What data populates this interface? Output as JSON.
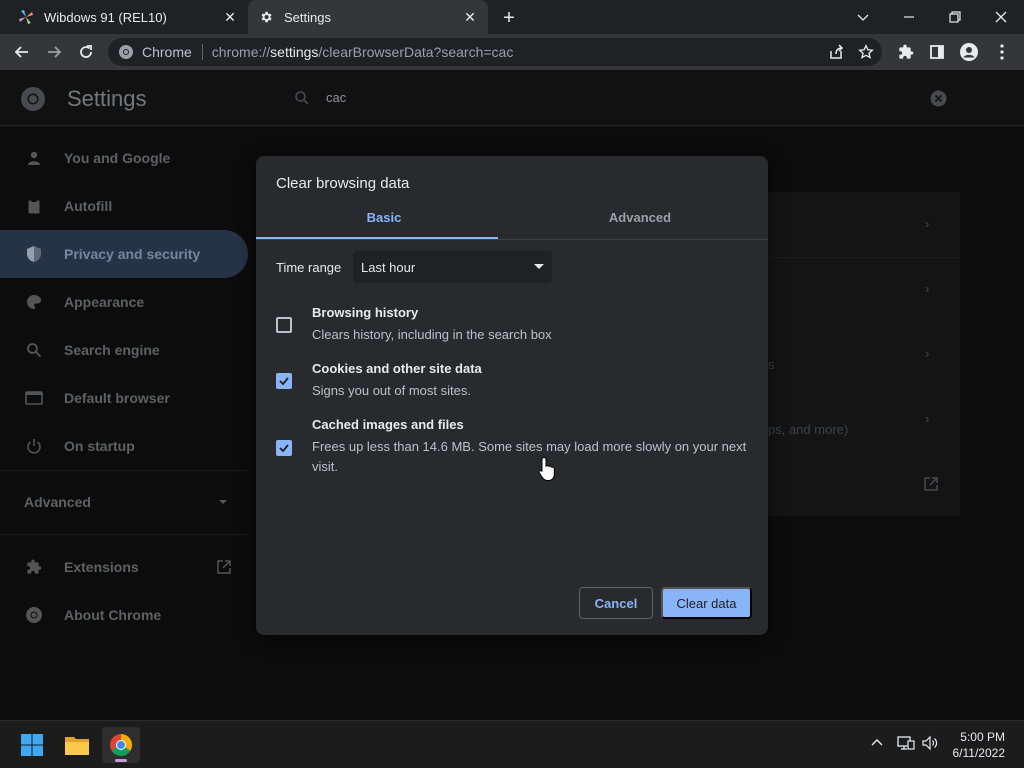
{
  "tabs": [
    {
      "label": "Wibdows 91 (REL10)",
      "icon": "windows-fan-icon",
      "active": false
    },
    {
      "label": "Settings",
      "icon": "gear-icon",
      "active": true
    }
  ],
  "omnibox": {
    "site_label": "Chrome",
    "url_prefix": "chrome://",
    "url_highlight": "settings",
    "url_suffix": "/clearBrowserData?search=cac"
  },
  "settings": {
    "title": "Settings",
    "search_value": "cac",
    "nav": [
      {
        "label": "You and Google",
        "icon": "person-icon"
      },
      {
        "label": "Autofill",
        "icon": "clipboard-icon"
      },
      {
        "label": "Privacy and security",
        "icon": "shield-icon",
        "selected": true
      },
      {
        "label": "Appearance",
        "icon": "palette-icon"
      },
      {
        "label": "Search engine",
        "icon": "search-icon"
      },
      {
        "label": "Default browser",
        "icon": "browser-icon"
      },
      {
        "label": "On startup",
        "icon": "power-icon"
      }
    ],
    "advanced_label": "Advanced",
    "extensions_label": "Extensions",
    "about_label": "About Chrome",
    "bg_fragments": [
      "s",
      "ps, and more)"
    ]
  },
  "dialog": {
    "title": "Clear browsing data",
    "tab_basic": "Basic",
    "tab_advanced": "Advanced",
    "time_range_label": "Time range",
    "time_range_value": "Last hour",
    "options": [
      {
        "title": "Browsing history",
        "desc": "Clears history, including in the search box",
        "checked": false
      },
      {
        "title": "Cookies and other site data",
        "desc": "Signs you out of most sites.",
        "checked": true
      },
      {
        "title": "Cached images and files",
        "desc": "Frees up less than 14.6 MB. Some sites may load more slowly on your next visit.",
        "checked": true
      }
    ],
    "cancel_label": "Cancel",
    "clear_label": "Clear data"
  },
  "taskbar": {
    "time": "5:00 PM",
    "date": "6/11/2022"
  },
  "colors": {
    "accent": "#8ab4f8",
    "dialog_bg": "#292a2d",
    "page_bg": "#202124"
  }
}
